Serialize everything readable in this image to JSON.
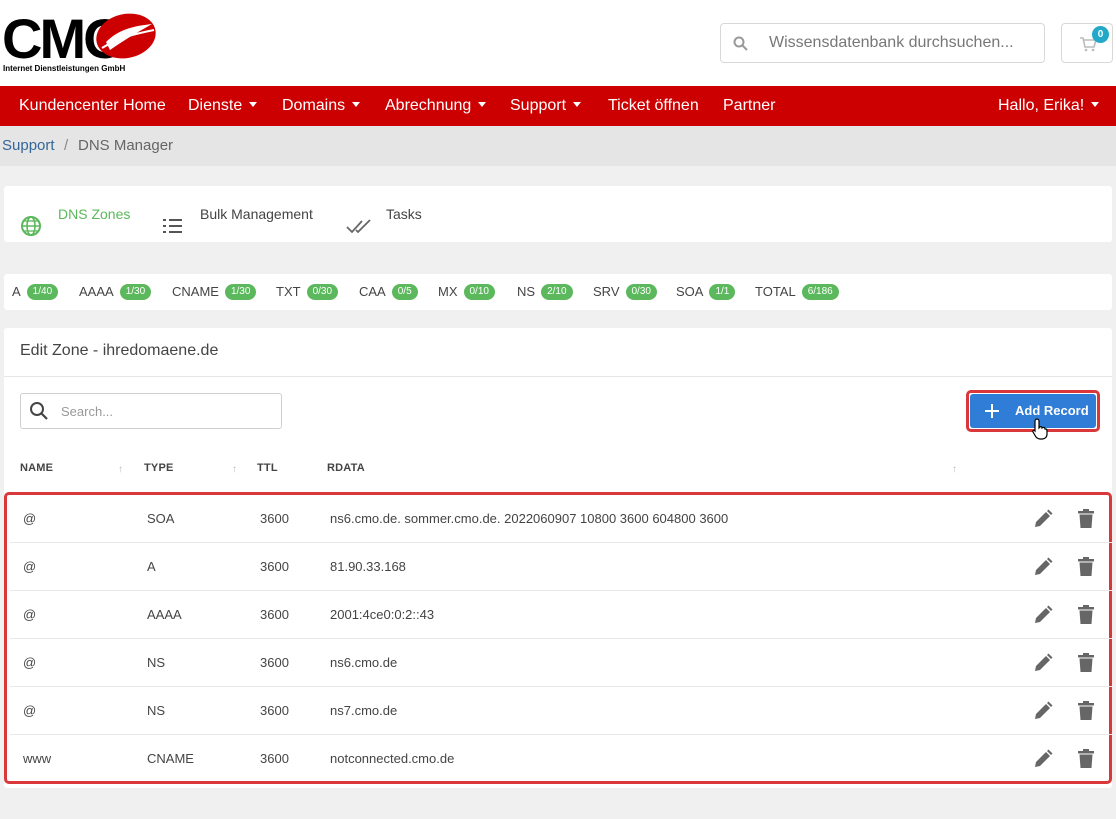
{
  "header": {
    "logo": {
      "text": "CMO",
      "subtext": "Internet Dienstleistungen GmbH",
      "color": "#cc0000"
    },
    "search_placeholder": "Wissensdatenbank durchsuchen...",
    "cart_count": "0"
  },
  "nav": {
    "items": [
      {
        "label": "Kundencenter Home",
        "dropdown": false
      },
      {
        "label": "Dienste",
        "dropdown": true
      },
      {
        "label": "Domains",
        "dropdown": true
      },
      {
        "label": "Abrechnung",
        "dropdown": true
      },
      {
        "label": "Support",
        "dropdown": true
      },
      {
        "label": "Ticket öffnen",
        "dropdown": false
      },
      {
        "label": "Partner",
        "dropdown": false
      }
    ],
    "user": "Hallo, Erika!",
    "bg_color": "#cc0000"
  },
  "breadcrumb": {
    "parent": "Support",
    "separator": "/",
    "current": "DNS Manager"
  },
  "tabs": [
    {
      "label": "DNS Zones",
      "icon": "globe-icon",
      "active": true
    },
    {
      "label": "Bulk Management",
      "icon": "list-icon",
      "active": false
    },
    {
      "label": "Tasks",
      "icon": "double-check-icon",
      "active": false
    }
  ],
  "record_counts": [
    {
      "type": "A",
      "count": "1/40"
    },
    {
      "type": "AAAA",
      "count": "1/30"
    },
    {
      "type": "CNAME",
      "count": "1/30"
    },
    {
      "type": "TXT",
      "count": "0/30"
    },
    {
      "type": "CAA",
      "count": "0/5"
    },
    {
      "type": "MX",
      "count": "0/10"
    },
    {
      "type": "NS",
      "count": "2/10"
    },
    {
      "type": "SRV",
      "count": "0/30"
    },
    {
      "type": "SOA",
      "count": "1/1"
    },
    {
      "type": "TOTAL",
      "count": "6/186"
    }
  ],
  "zone": {
    "title": "Edit Zone - ihredomaene.de",
    "search_placeholder": "Search...",
    "add_record_label": "Add Record",
    "columns": [
      "NAME",
      "TYPE",
      "TTL",
      "RDATA"
    ],
    "records": [
      {
        "name": "@",
        "type": "SOA",
        "ttl": "3600",
        "rdata": "ns6.cmo.de. sommer.cmo.de. 2022060907 10800 3600 604800 3600"
      },
      {
        "name": "@",
        "type": "A",
        "ttl": "3600",
        "rdata": "81.90.33.168"
      },
      {
        "name": "@",
        "type": "AAAA",
        "ttl": "3600",
        "rdata": "2001:4ce0:0:2::43"
      },
      {
        "name": "@",
        "type": "NS",
        "ttl": "3600",
        "rdata": "ns6.cmo.de"
      },
      {
        "name": "@",
        "type": "NS",
        "ttl": "3600",
        "rdata": "ns7.cmo.de"
      },
      {
        "name": "www",
        "type": "CNAME",
        "ttl": "3600",
        "rdata": "notconnected.cmo.de"
      }
    ]
  },
  "colors": {
    "accent_green": "#5cb85c",
    "button_blue": "#2f7dd6",
    "highlight_red": "#d9373a"
  }
}
